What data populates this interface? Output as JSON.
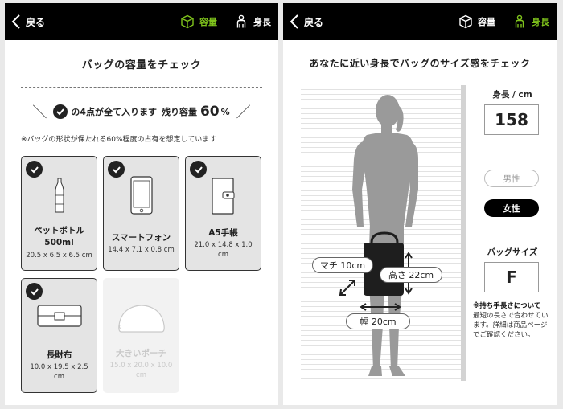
{
  "left": {
    "header": {
      "back_label": "戻る",
      "tab_capacity": "容量",
      "tab_height": "身長"
    },
    "title": "バッグの容量をチェック",
    "summary": {
      "prefix": "の4点が全て入ります",
      "remain_label": "残り容量",
      "remain_value": "60",
      "remain_unit": "%"
    },
    "note": "※バッグの形状が保たれる60%程度の占有を想定しています",
    "items": [
      {
        "name_line1": "ペットボトル",
        "name_line2": "500ml",
        "size": "20.5 x 6.5 x 6.5 cm",
        "checked": true,
        "icon": "bottle-icon"
      },
      {
        "name_line1": "スマートフォン",
        "name_line2": "",
        "size": "14.4 x 7.1 x 0.8 cm",
        "checked": true,
        "icon": "smartphone-icon"
      },
      {
        "name_line1": "A5手帳",
        "name_line2": "",
        "size": "21.0 x 14.8 x 1.0 cm",
        "checked": true,
        "icon": "notebook-icon"
      },
      {
        "name_line1": "長財布",
        "name_line2": "",
        "size": "10.0 x 19.5 x 2.5 cm",
        "checked": true,
        "icon": "wallet-icon"
      },
      {
        "name_line1": "大きいポーチ",
        "name_line2": "",
        "size": "15.0 x 20.0 x 10.0 cm",
        "checked": false,
        "icon": "pouch-icon"
      }
    ]
  },
  "right": {
    "header": {
      "back_label": "戻る",
      "tab_capacity": "容量",
      "tab_height": "身長"
    },
    "title": "あなたに近い身長でバッグのサイズ感をチェック",
    "height_label": "身長 / cm",
    "height_value": "158",
    "gender_male": "男性",
    "gender_female": "女性",
    "bag_size_label": "バッグサイズ",
    "bag_size_value": "F",
    "note_bold": "※持ち手長さについて",
    "note_text": "最短の長さで合わせています。詳細は商品ページでご確認ください。",
    "dim_depth": "マチ 10cm",
    "dim_height": "高さ 22cm",
    "dim_width": "幅 20cm"
  },
  "colors": {
    "accent": "#7fc31c",
    "header_bg": "#000000",
    "card_bg": "#e4e4e4"
  }
}
